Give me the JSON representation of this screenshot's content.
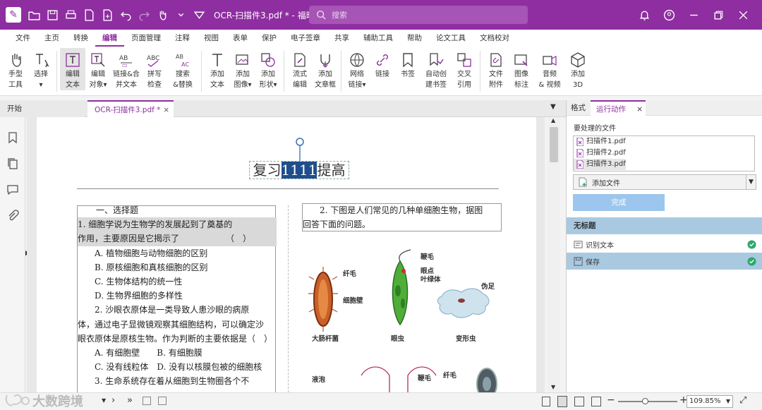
{
  "titlebar": {
    "doc_title": "OCR-扫描件3.pdf * - 福昕...",
    "search_placeholder": "搜索"
  },
  "menu": [
    "文件",
    "主页",
    "转换",
    "编辑",
    "页面管理",
    "注释",
    "视图",
    "表单",
    "保护",
    "电子签章",
    "共享",
    "辅助工具",
    "帮助",
    "论文工具",
    "文档校对"
  ],
  "ribbon": [
    {
      "l1": "手型",
      "l2": "工具"
    },
    {
      "l1": "选择",
      "l2": "▾"
    },
    {
      "l1": "编辑",
      "l2": "文本"
    },
    {
      "l1": "编辑",
      "l2": "对象▾"
    },
    {
      "l1": "链接&合",
      "l2": "并文本"
    },
    {
      "l1": "拼写",
      "l2": "检查"
    },
    {
      "l1": "搜索",
      "l2": "&替换"
    },
    {
      "l1": "添加",
      "l2": "文本"
    },
    {
      "l1": "添加",
      "l2": "图像▾"
    },
    {
      "l1": "添加",
      "l2": "形状▾"
    },
    {
      "l1": "流式",
      "l2": "编辑"
    },
    {
      "l1": "添加",
      "l2": "文章框"
    },
    {
      "l1": "网络",
      "l2": "链接▾"
    },
    {
      "l1": "链接",
      "l2": ""
    },
    {
      "l1": "书签",
      "l2": ""
    },
    {
      "l1": "自动创",
      "l2": "建书签"
    },
    {
      "l1": "交叉",
      "l2": "引用"
    },
    {
      "l1": "文件",
      "l2": "附件"
    },
    {
      "l1": "图像",
      "l2": "标注"
    },
    {
      "l1": "音频",
      "l2": "& 视频"
    },
    {
      "l1": "添加",
      "l2": "3D"
    }
  ],
  "tabs": {
    "start": "开始",
    "doc": "OCR-扫描件3.pdf *",
    "close": "×"
  },
  "document": {
    "title_pre": "复习",
    "title_sel": "1111",
    "title_post": "提高",
    "left_lines": [
      "一、选择题",
      "1. 细胞学说为生物学的发展起到了奠基的",
      "作用，主要原因是它揭示了　　　　　　（　）",
      "A. 植物细胞与动物细胞的区别",
      "B. 原核细胞和真核细胞的区别",
      "C. 生物体结构的统一性",
      "D. 生物界细胞的多样性",
      "2. 沙眼衣原体是一类导致人患沙眼的病原",
      "体，通过电子显微镜观察其细胞结构，可以确定沙",
      "眼衣原体是原核生物。作为判断的主要依据是（　）",
      "A. 有细胞壁　　B. 有细胞膜",
      "C. 没有线粒体　D. 没有以核膜包被的细胞核",
      "3. 生命系统存在着从细胞到生物圈各个不"
    ],
    "right_q1": "2. 下图是人们常见的几种单细胞生物，据图",
    "right_q2": "回答下面的问题。",
    "bio_labels": {
      "cilia": "纤毛",
      "wall": "细胞壁",
      "ecoli": "大肠杆菌",
      "flagellum": "鞭毛",
      "eyespot": "眼点",
      "chloroplast": "叶绿体",
      "euglena": "眼虫",
      "pseudopod": "伪足",
      "amoeba": "变形虫",
      "vacuole": "液泡",
      "flagellum2": "鞭毛",
      "cilia2": "纤毛"
    }
  },
  "right_panel": {
    "tab_format": "格式",
    "tab_action": "运行动作",
    "close": "×",
    "files_label": "要处理的文件",
    "files": [
      "扫描件1.pdf",
      "扫描件2.pdf",
      "扫描件3.pdf"
    ],
    "add_file": "添加文件",
    "finish": "完成",
    "section": "无标题",
    "steps": [
      "识别文本",
      "保存"
    ]
  },
  "status": {
    "zoom": "109.85%",
    "watermark": "大数跨境"
  },
  "colors": {
    "brand": "#8e2ea0",
    "accent": "#5b9bd5",
    "check": "#2ea86b"
  }
}
